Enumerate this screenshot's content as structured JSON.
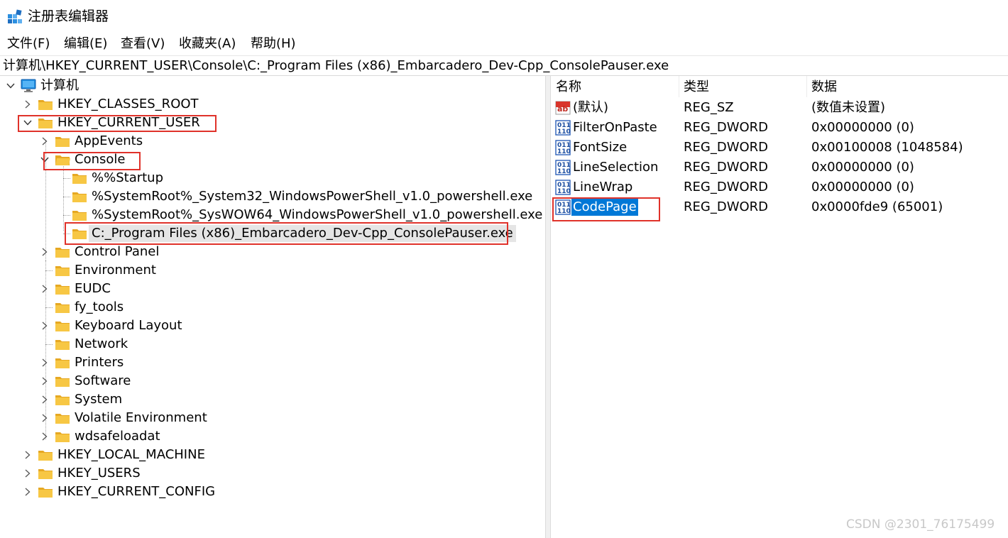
{
  "window": {
    "title": "注册表编辑器",
    "icon": "registry-editor-icon"
  },
  "menu": [
    "文件(F)",
    "编辑(E)",
    "查看(V)",
    "收藏夹(A)",
    "帮助(H)"
  ],
  "address": "计算机\\HKEY_CURRENT_USER\\Console\\C:_Program Files (x86)_Embarcadero_Dev-Cpp_ConsolePauser.exe",
  "tree": {
    "root": "计算机",
    "hives": [
      "HKEY_CLASSES_ROOT",
      "HKEY_CURRENT_USER",
      "HKEY_LOCAL_MACHINE",
      "HKEY_USERS",
      "HKEY_CURRENT_CONFIG"
    ],
    "hkcu_children": [
      "AppEvents",
      "Console",
      "Control Panel",
      "Environment",
      "EUDC",
      "fy_tools",
      "Keyboard Layout",
      "Network",
      "Printers",
      "Software",
      "System",
      "Volatile Environment",
      "wdsafeloadat"
    ],
    "console_children": [
      "%%Startup",
      "%SystemRoot%_System32_WindowsPowerShell_v1.0_powershell.exe",
      "%SystemRoot%_SysWOW64_WindowsPowerShell_v1.0_powershell.exe",
      "C:_Program Files (x86)_Embarcadero_Dev-Cpp_ConsolePauser.exe"
    ]
  },
  "list": {
    "headers": {
      "name": "名称",
      "type": "类型",
      "data": "数据"
    },
    "rows": [
      {
        "name": "(默认)",
        "type": "REG_SZ",
        "data": "(数值未设置)",
        "icon": "string-value-icon"
      },
      {
        "name": "FilterOnPaste",
        "type": "REG_DWORD",
        "data": "0x00000000 (0)",
        "icon": "binary-value-icon"
      },
      {
        "name": "FontSize",
        "type": "REG_DWORD",
        "data": "0x00100008 (1048584)",
        "icon": "binary-value-icon"
      },
      {
        "name": "LineSelection",
        "type": "REG_DWORD",
        "data": "0x00000000 (0)",
        "icon": "binary-value-icon"
      },
      {
        "name": "LineWrap",
        "type": "REG_DWORD",
        "data": "0x00000000 (0)",
        "icon": "binary-value-icon"
      },
      {
        "name": "CodePage",
        "type": "REG_DWORD",
        "data": "0x0000fde9 (65001)",
        "icon": "binary-value-icon"
      }
    ]
  },
  "watermark": "CSDN @2301_76175499",
  "colors": {
    "selection": "#0078d7",
    "highlight_box": "#e0322a",
    "folder": "#f5c13b"
  }
}
